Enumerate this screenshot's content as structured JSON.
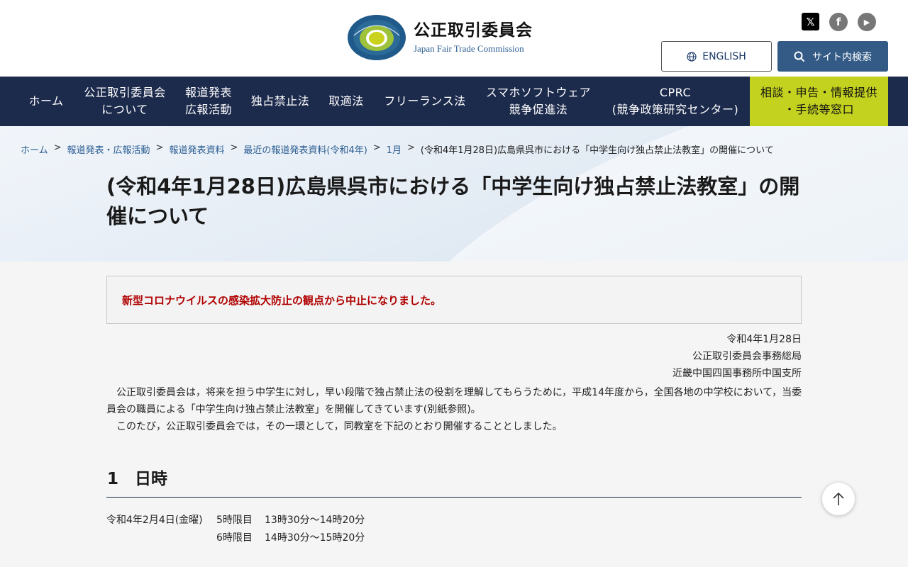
{
  "header": {
    "logo_title": "公正取引委員会",
    "logo_subtitle": "Japan Fair Trade Commission",
    "english_label": "ENGLISH",
    "search_label": "サイト内検索"
  },
  "sns": [
    {
      "name": "x-icon",
      "glyph": "𝕏"
    },
    {
      "name": "facebook-icon",
      "glyph": "f"
    },
    {
      "name": "youtube-icon",
      "glyph": "▶"
    }
  ],
  "nav": [
    {
      "label": "ホーム"
    },
    {
      "label": "公正取引委員会\nについて"
    },
    {
      "label": "報道発表\n広報活動"
    },
    {
      "label": "独占禁止法"
    },
    {
      "label": "取適法"
    },
    {
      "label": "フリーランス法"
    },
    {
      "label": "スマホソフトウェア\n競争促進法"
    },
    {
      "label": "CPRC\n(競争政策研究センター)"
    },
    {
      "label": "相談・申告・情報提供\n・手続等窓口"
    }
  ],
  "breadcrumb": {
    "items": [
      "ホーム",
      "報道発表・広報活動",
      "報道発表資料",
      "最近の報道発表資料(令和4年)",
      "1月"
    ],
    "current": "(令和4年1月28日)広島県呉市における「中学生向け独占禁止法教室」の開催について",
    "separator": ">"
  },
  "page_title": "(令和4年1月28日)広島県呉市における「中学生向け独占禁止法教室」の開催について",
  "notice": "新型コロナウイルスの感染拡大防止の観点から中止になりました。",
  "meta": {
    "date": "令和4年1月28日",
    "office": "公正取引委員会事務総局",
    "branch": "近畿中国四国事務所中国支所"
  },
  "body": {
    "para1": "　公正取引委員会は，将来を担う中学生に対し，早い段階で独占禁止法の役割を理解してもらうために，平成14年度から，全国各地の中学校において，当委員会の職員による「中学生向け独占禁止法教室」を開催してきています(別紙参照)。",
    "para2": "　このたび，公正取引委員会では，その一環として，同教室を下記のとおり開催することとしました。"
  },
  "section1": {
    "heading": "1　日時",
    "date": "令和4年2月4日(金曜)",
    "rows": [
      {
        "period": "5時限目",
        "time": "13時30分～14時20分"
      },
      {
        "period": "6時限目",
        "time": "14時30分～15時20分"
      }
    ]
  },
  "to_top_label": "↑"
}
